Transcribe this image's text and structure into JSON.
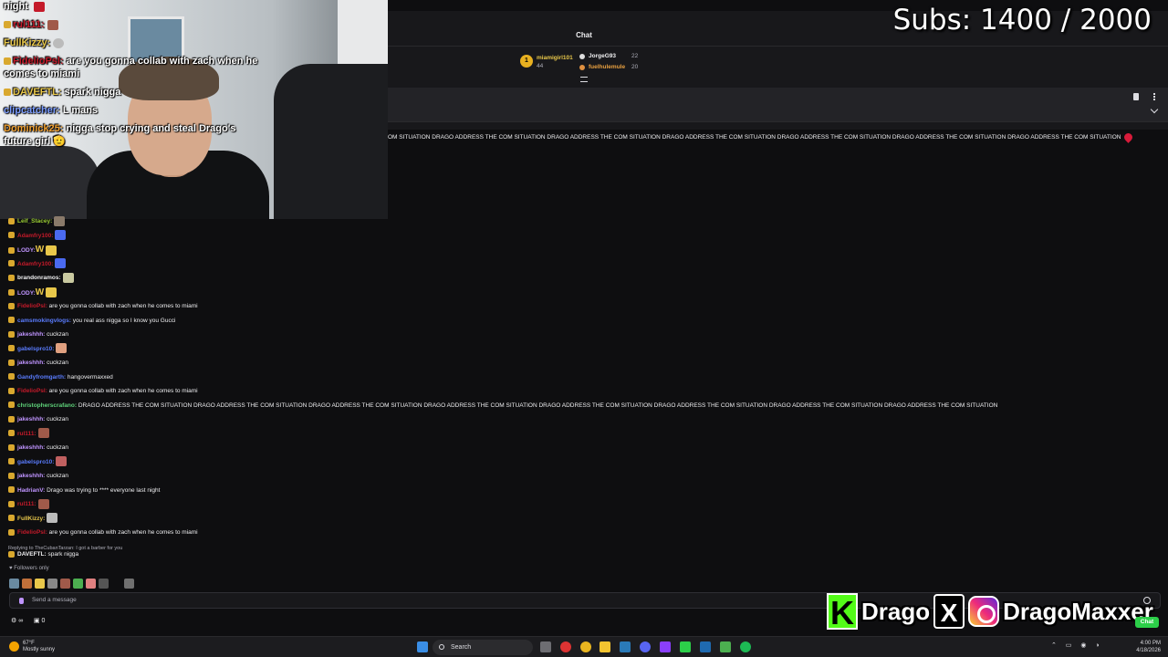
{
  "overlay": {
    "subs_label": "Subs: 1400 / 2000",
    "cam_chat": [
      {
        "user": "",
        "text": "night",
        "cls": ""
      },
      {
        "user": "rul111:",
        "text": "",
        "cls": ""
      },
      {
        "user": "FullKizzy:",
        "text": "",
        "cls": "yl"
      },
      {
        "user": "FidelioPsl:",
        "text": "are you gonna collab with zach when he",
        "cls": ""
      },
      {
        "user": "",
        "text": "comes to miami",
        "cls": ""
      },
      {
        "user": "DAVEFTL:",
        "text": "spark nigga",
        "cls": "yl"
      },
      {
        "user": "clipcatcher:",
        "text": "L mans",
        "cls": "bl"
      },
      {
        "user": "Dominick25:",
        "text": "nigga stop crying and steal Drago's",
        "cls": "or"
      },
      {
        "user": "",
        "text": "future girl 🫡",
        "cls": ""
      }
    ]
  },
  "chat_window": {
    "title": "Chat",
    "leaders": {
      "first_rank": "1",
      "first_name": "miamigirl101",
      "first_count": "44",
      "second_name": "JorgeG93",
      "second_count": "22",
      "third_name": "fuelhulemule",
      "third_count": "20"
    },
    "spam_top": "OM SITUATION DRAGO ADDRESS THE COM SITUATION DRAGO ADDRESS THE COM SITUATION DRAGO ADDRESS THE COM SITUATION DRAGO ADDRESS THE COM SITUATION DRAGO ADDRESS THE COM SITUATION DRAGO ADDRESS THE COM SITUATION"
  },
  "chat": {
    "messages": [
      {
        "user": "Leif_Stacey:",
        "text": "",
        "color": "#9acd32"
      },
      {
        "user": "Adamfry100:",
        "text": "",
        "color": "#c41a2a"
      },
      {
        "user": "LODY:",
        "text": "W",
        "color": "#bf94ff"
      },
      {
        "user": "Adamfry100:",
        "text": "",
        "color": "#c41a2a"
      },
      {
        "user": "brandonramos:",
        "text": "",
        "color": "#efeff1"
      },
      {
        "user": "LODY:",
        "text": "W",
        "color": "#bf94ff"
      },
      {
        "user": "FidelioPsl:",
        "text": " are you gonna collab with zach when he comes to miami",
        "color": "#c41a2a"
      },
      {
        "user": "camsmokingvlogs:",
        "text": " you real ass nigga so I know you Gucci",
        "color": "#5a7cff"
      },
      {
        "user": "jakeshhh:",
        "text": " cuckzan",
        "color": "#bf94ff"
      },
      {
        "user": "gabelspro10:",
        "text": "",
        "color": "#5a7cff"
      },
      {
        "user": "jakeshhh:",
        "text": " cuckzan",
        "color": "#bf94ff"
      },
      {
        "user": "Gandyfromgarth:",
        "text": " hangovermaxxed",
        "color": "#5a7cff"
      },
      {
        "user": "FidelioPsl:",
        "text": " are you gonna collab with zach when he comes to miami",
        "color": "#c41a2a"
      },
      {
        "user": "christopherscrafano:",
        "text": " DRAGO ADDRESS THE COM SITUATION DRAGO ADDRESS THE COM SITUATION DRAGO ADDRESS THE COM SITUATION DRAGO ADDRESS THE COM SITUATION DRAGO ADDRESS THE COM SITUATION DRAGO ADDRESS THE COM SITUATION DRAGO ADDRESS THE COM SITUATION DRAGO ADDRESS THE COM SITUATION",
        "color": "#5fd37a"
      },
      {
        "user": "jakeshhh:",
        "text": " cuckzan",
        "color": "#bf94ff"
      },
      {
        "user": "rul111:",
        "text": "",
        "color": "#c41a2a"
      },
      {
        "user": "jakeshhh:",
        "text": " cuckzan",
        "color": "#bf94ff"
      },
      {
        "user": "gabelspro10:",
        "text": "",
        "color": "#5a7cff"
      },
      {
        "user": "jakeshhh:",
        "text": " cuckzan",
        "color": "#bf94ff"
      },
      {
        "user": "HadrianV:",
        "text": " Drago was trying to **** everyone last night",
        "color": "#bf94ff"
      },
      {
        "user": "rul111:",
        "text": "",
        "color": "#c41a2a"
      },
      {
        "user": "FullKizzy:",
        "text": "",
        "color": "#e8c74a"
      },
      {
        "user": "FidelioPsl:",
        "text": " are you gonna collab with zach when he comes to miami",
        "color": "#c41a2a"
      }
    ],
    "reply_to": "Replying to TheCubanTarzan: I got a barber for you",
    "last_user": "DAVEFTL:",
    "last_text": " spark nigga",
    "followers_only": "Followers only",
    "input_placeholder": "Send a message",
    "bits": "0",
    "chat_button": "Chat"
  },
  "branding": {
    "k": "K",
    "name1": "Drago",
    "x": "X",
    "name2": "DragoMaxxer"
  },
  "taskbar": {
    "temp": "67°F",
    "weather": "Mostly sunny",
    "search": "Search",
    "time": "4:00 PM",
    "date": "4/18/2026"
  }
}
